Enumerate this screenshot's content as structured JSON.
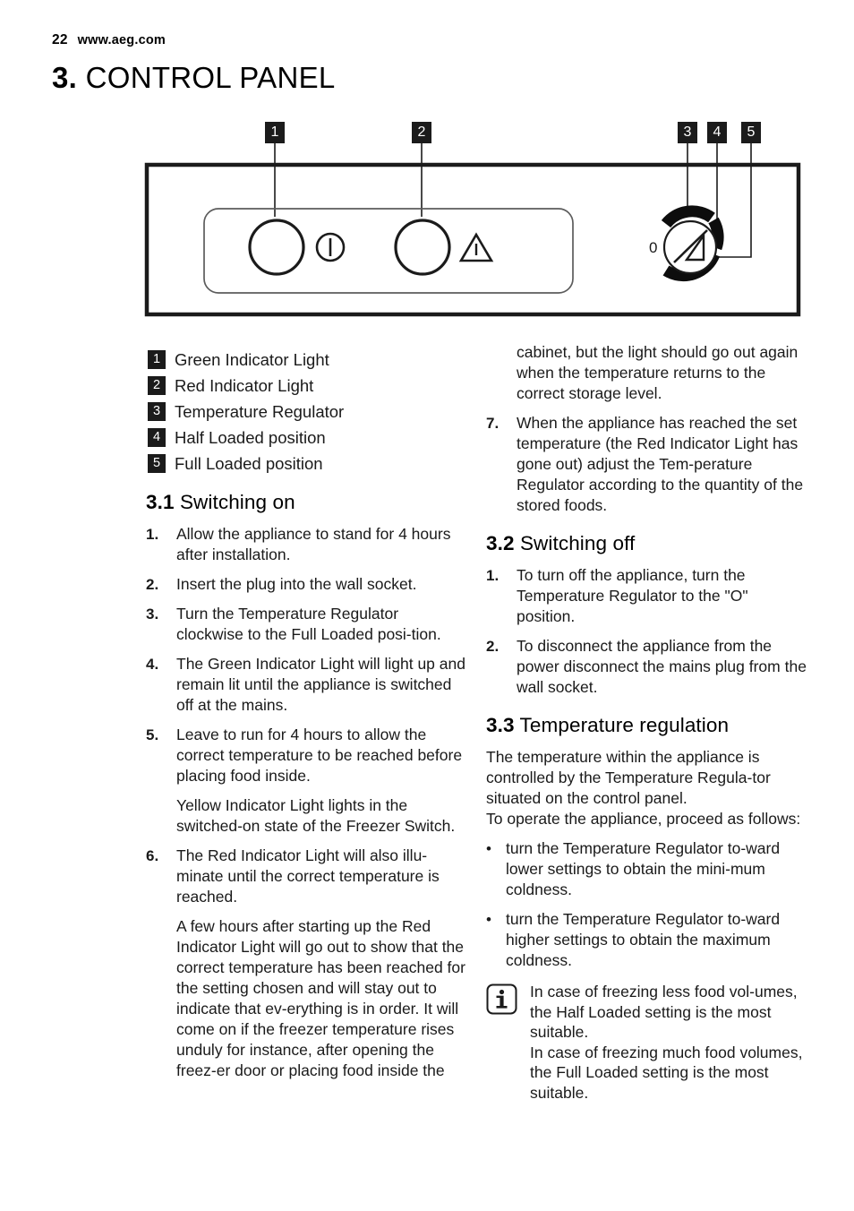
{
  "header": {
    "page_number": "22",
    "site_url": "www.aeg.com"
  },
  "chapter": {
    "number": "3.",
    "title": "CONTROL PANEL"
  },
  "diagram": {
    "callouts": [
      "1",
      "2",
      "3",
      "4",
      "5"
    ],
    "knob_zero_label": "0",
    "icons": {
      "power": "power-icon",
      "warning": "warning-triangle-icon",
      "knob": "temperature-regulator-knob-icon"
    }
  },
  "legend": [
    {
      "num": "1",
      "label": "Green Indicator Light"
    },
    {
      "num": "2",
      "label": "Red Indicator Light"
    },
    {
      "num": "3",
      "label": "Temperature Regulator"
    },
    {
      "num": "4",
      "label": "Half Loaded position"
    },
    {
      "num": "5",
      "label": "Full Loaded position"
    }
  ],
  "sections": {
    "switching_on": {
      "number": "3.1",
      "title": "Switching on",
      "steps": [
        {
          "marker": "1.",
          "text": "Allow the appliance to stand for 4 hours after installation."
        },
        {
          "marker": "2.",
          "text": "Insert the plug into the wall socket."
        },
        {
          "marker": "3.",
          "text": "Turn the Temperature Regulator clockwise to the Full Loaded posi-tion."
        },
        {
          "marker": "4.",
          "text": "The Green Indicator Light will light up and remain lit until the appliance is switched off at the mains."
        },
        {
          "marker": "5.",
          "text": "Leave to run for 4 hours to allow the correct temperature to be reached before placing food inside.",
          "extra": "Yellow Indicator Light lights in the switched-on state of the Freezer Switch."
        },
        {
          "marker": "6.",
          "text": "The Red Indicator Light will also illu-minate until the correct temperature is reached.",
          "extra": "A few hours after starting up the Red Indicator Light will go out to show that the correct temperature has been reached for the setting chosen and will stay out to indicate that ev-erything is in order. It will come on if the freezer temperature rises unduly for instance, after opening the freez-er door or placing food inside the"
        }
      ]
    },
    "continuation": {
      "text": "cabinet, but the light should go out again when the temperature returns to the correct storage level.",
      "step7": {
        "marker": "7.",
        "text": "When the appliance has reached the set temperature (the Red Indicator Light has gone out) adjust the Tem-perature Regulator according to the quantity of the stored foods."
      }
    },
    "switching_off": {
      "number": "3.2",
      "title": "Switching off",
      "steps": [
        {
          "marker": "1.",
          "text": "To turn off the appliance, turn the Temperature Regulator to the \"O\" position."
        },
        {
          "marker": "2.",
          "text": "To disconnect the appliance from the power disconnect the mains plug from the wall socket."
        }
      ]
    },
    "temperature_regulation": {
      "number": "3.3",
      "title": "Temperature regulation",
      "intro": "The temperature within the appliance is controlled by the Temperature Regula-tor situated on the control panel.\nTo operate the appliance, proceed as follows:",
      "bullets": [
        {
          "bullet": "•",
          "text": "turn the Temperature Regulator to-ward lower settings to obtain the mini-mum coldness."
        },
        {
          "bullet": "•",
          "text": "turn the Temperature Regulator to-ward higher settings to obtain the maximum coldness."
        }
      ],
      "note": {
        "line1": "In case of freezing less food vol-umes, the Half Loaded setting is the most suitable.",
        "line2": "In case of freezing much food volumes, the Full Loaded setting is the most suitable."
      }
    }
  }
}
